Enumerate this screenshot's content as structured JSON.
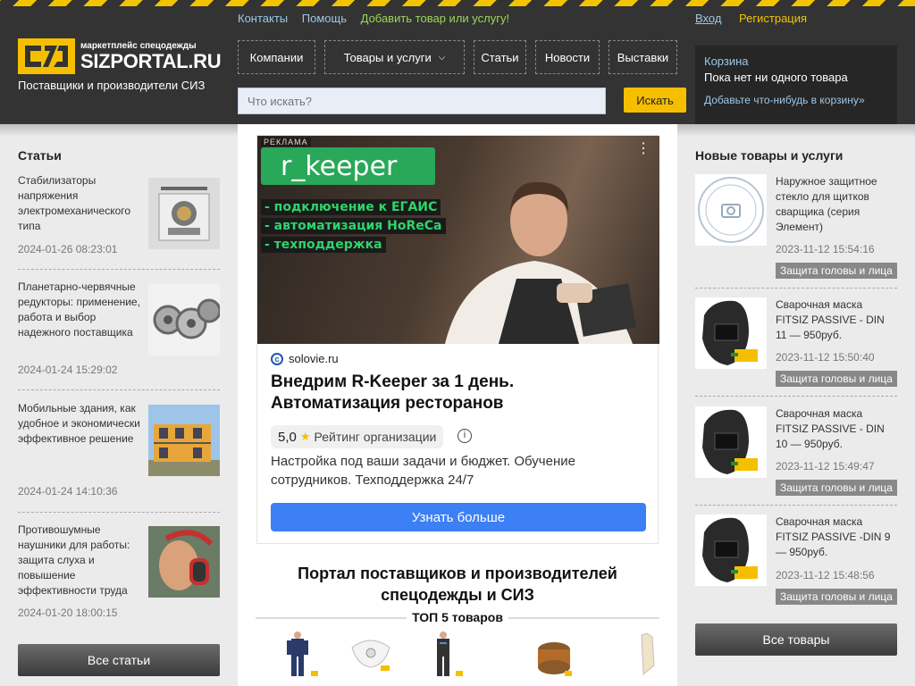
{
  "header": {
    "logo_small": "маркетплейс спецодежды",
    "logo_big": "SIZPORTAL.RU",
    "tagline": "Поставщики и производители СИЗ",
    "top_links": [
      "Контакты",
      "Помощь",
      "Добавить товар или услугу!"
    ],
    "login": "Вход",
    "register": "Регистрация",
    "nav": [
      "Компании",
      "Товары и услуги",
      "Статьи",
      "Новости",
      "Выставки"
    ],
    "search_placeholder": "Что искать?",
    "search_button": "Искать",
    "cart": {
      "title": "Корзина",
      "empty": "Пока нет ни одного товара",
      "add": "Добавьте что-нибудь в корзину»"
    },
    "colors": {
      "accent": "#f5bf00",
      "header_bg": "#333333",
      "link": "#9ec7e6"
    }
  },
  "articles": {
    "title": "Статьи",
    "items": [
      {
        "title": "Стабилизаторы напряжения электромеханического типа",
        "date": "2024-01-26 08:23:01",
        "image": "stabilizer-image"
      },
      {
        "title": "Планетарно-червячные редукторы: применение, работа и выбор надежного поставщика",
        "date": "2024-01-24 15:29:02",
        "image": "gear-reducer-image"
      },
      {
        "title": "Мобильные здания, как удобное и экономически эффективное решение",
        "date": "2024-01-24 14:10:36",
        "image": "modular-building-image"
      },
      {
        "title": "Противошумные наушники для работы: защита слуха и повышение эффективности труда",
        "date": "2024-01-20 18:00:15",
        "image": "ear-muffs-image"
      }
    ],
    "all_button": "Все статьи"
  },
  "ad": {
    "label": "РЕКЛАМА",
    "brand": "r_keeper",
    "lines": [
      "- подключение к ЕГАИС",
      "- автоматизация HoReCa",
      "- техподдержка"
    ],
    "domain": "solovie.ru",
    "headline": "Внедрим R-Keeper за 1 день. Автоматизация ресторанов",
    "rating": "5,0",
    "rating_label": "Рейтинг организации",
    "description": "Настройка под ваши задачи и бюджет. Обучение сотрудников. Техподдержка 24/7",
    "button": "Узнать больше"
  },
  "main": {
    "title": "Портал поставщиков и производителей спецодежды и СИЗ",
    "top5": "ТОП 5 товаров",
    "products": [
      "workwear-suit-image",
      "respirator-image",
      "workwear-suit-2-image",
      "cream-jar-image",
      "gloves-image"
    ]
  },
  "new_items": {
    "title": "Новые товары и услуги",
    "items": [
      {
        "title": "Наружное защитное стекло для щитков сварщика (серия Элемент)",
        "date": "2023-11-12 15:54:16",
        "category": "Защита головы и лица",
        "image": "no-photo-placeholder"
      },
      {
        "title": "Сварочная маска FITSIZ PASSIVE - DIN 11 — 950руб.",
        "date": "2023-11-12 15:50:40",
        "category": "Защита головы и лица",
        "image": "welding-mask-image"
      },
      {
        "title": "Сварочная маска FITSIZ PASSIVE - DIN 10 — 950руб.",
        "date": "2023-11-12 15:49:47",
        "category": "Защита головы и лица",
        "image": "welding-mask-image"
      },
      {
        "title": "Сварочная маска FITSIZ PASSIVE -DIN 9 — 950руб.",
        "date": "2023-11-12 15:48:56",
        "category": "Защита головы и лица",
        "image": "welding-mask-image"
      }
    ],
    "all_button": "Все товары"
  }
}
